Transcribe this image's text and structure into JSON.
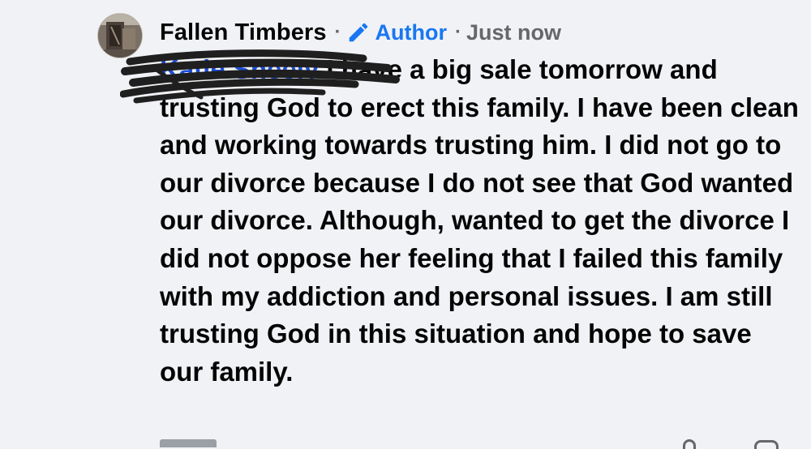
{
  "comment": {
    "author": "Fallen Timbers",
    "separator": "·",
    "badge_label": "Author",
    "badge_icon": "pencil-icon",
    "badge_color": "#1877f2",
    "timestamp": "Just now",
    "mention": "Katie Sheely",
    "text": " I have a big sale tomorrow and trusting God to erect this family. I have been clean and working towards trusting him. I did not go to our divorce because I do not see that God wanted our divorce. Although, wanted to get the divorce I did not oppose her feeling that I failed this family with my addiction and personal issues. I am still trusting God in this situation and hope to save our family.",
    "mention_redacted": true
  },
  "colors": {
    "background": "#f0f2f5",
    "text": "#050505",
    "secondary_text": "#65676b",
    "accent": "#1877f2"
  }
}
